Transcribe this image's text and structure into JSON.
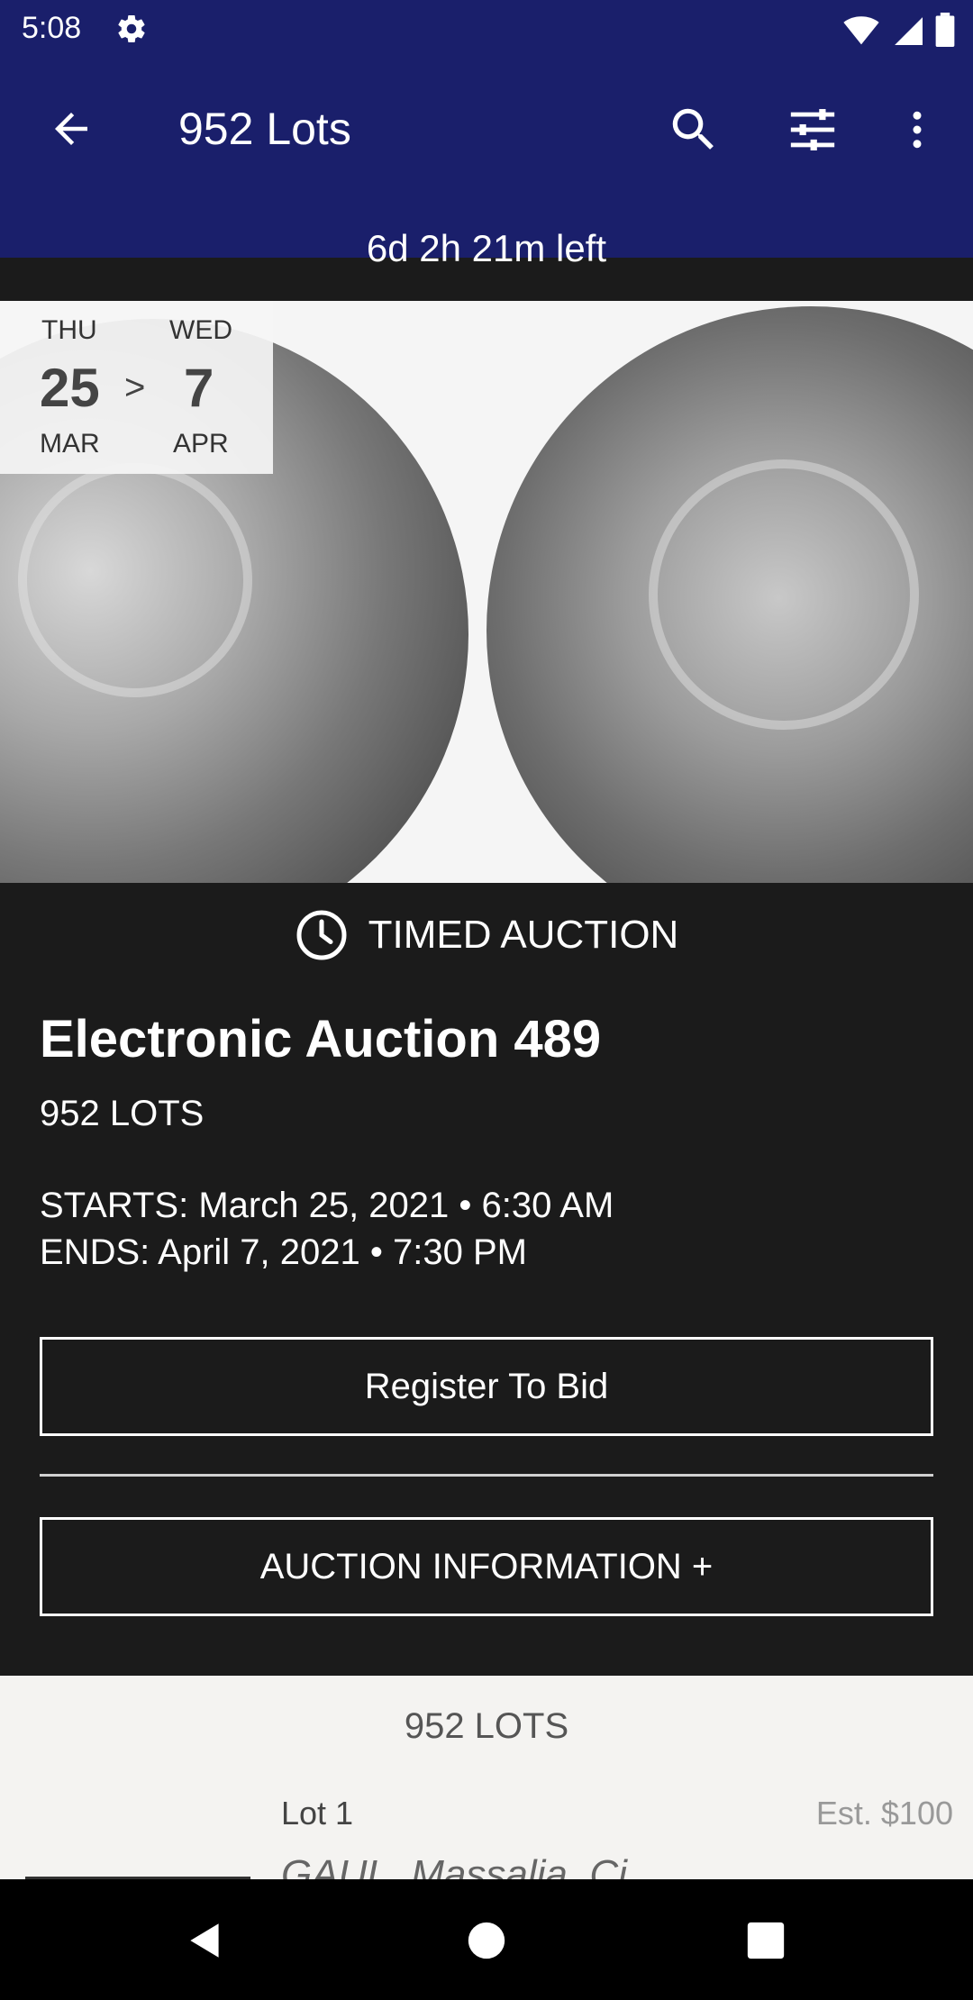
{
  "status_bar": {
    "time": "5:08",
    "icons": [
      "settings-gear-icon",
      "wifi-icon",
      "cellular-signal-icon",
      "battery-icon"
    ]
  },
  "app_bar": {
    "title": "952 Lots",
    "time_left": "6d 2h 21m left",
    "background_color": "#1a1f6b",
    "actions": [
      "search-icon",
      "filter-sliders-icon",
      "more-vert-icon"
    ]
  },
  "date_range": {
    "start": {
      "dow": "THU",
      "day": "25",
      "month": "MAR"
    },
    "separator": ">",
    "end": {
      "dow": "WED",
      "day": "7",
      "month": "APR"
    }
  },
  "auction": {
    "type_label": "TIMED AUCTION",
    "name": "Electronic Auction 489",
    "lots_count": "952 LOTS",
    "starts": "STARTS: March 25, 2021 • 6:30 AM",
    "ends": "ENDS: April 7, 2021 • 7:30 PM",
    "register_label": "Register To Bid",
    "info_label": "AUCTION INFORMATION +"
  },
  "lots": {
    "heading": "952 LOTS",
    "items": [
      {
        "label": "Lot 1",
        "estimate": "Est. $100",
        "description": "GAUL, Massalia. Ci..."
      }
    ]
  },
  "nav_bar": {
    "buttons": [
      "back-triangle-icon",
      "home-circle-icon",
      "recents-square-icon"
    ]
  }
}
